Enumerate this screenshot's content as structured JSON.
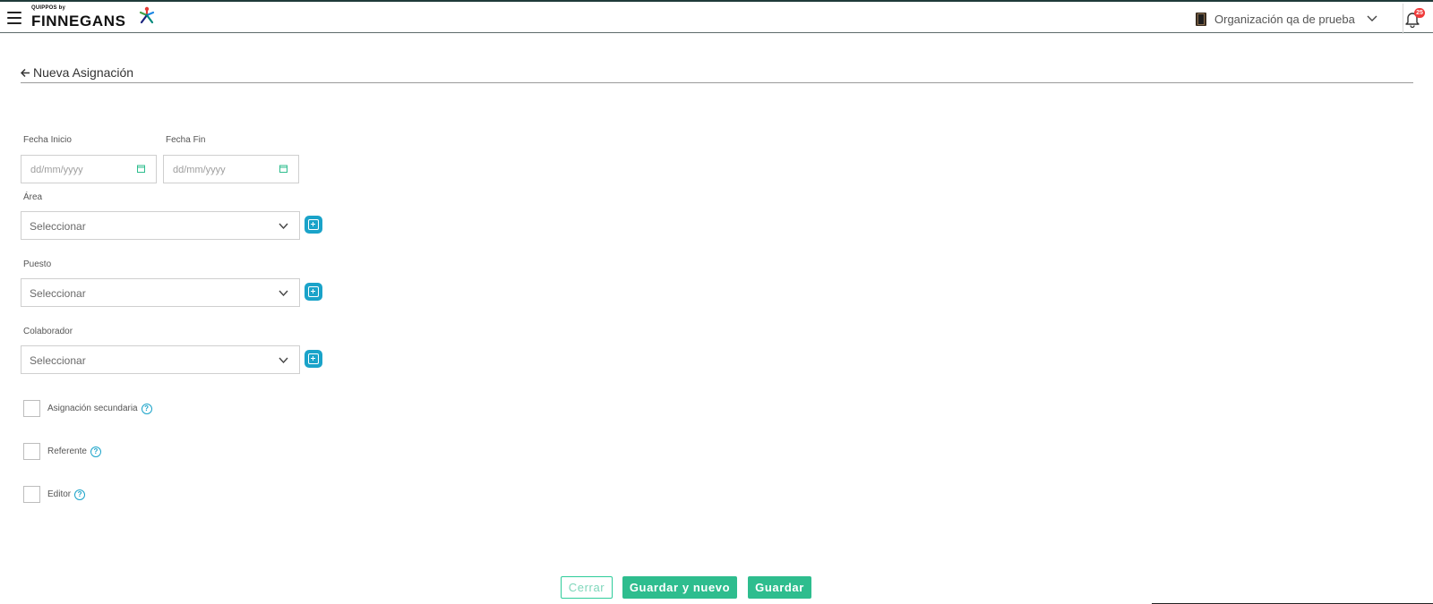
{
  "app": {
    "logo_small": "QUIPPOS by",
    "logo_main": "FINNEGANS",
    "logo_icon": "finnegans-star-icon"
  },
  "header": {
    "organization": "Organización qa de prueba",
    "org_icon": "building-icon",
    "notifications_count": "25",
    "menu_icon": "hamburger-icon",
    "bell_icon": "bell-icon"
  },
  "page": {
    "title": "Nueva Asignación",
    "back_icon": "arrow-left-icon"
  },
  "form": {
    "fecha_inicio": {
      "label": "Fecha Inicio",
      "placeholder": "dd/mm/yyyy"
    },
    "fecha_fin": {
      "label": "Fecha Fin",
      "placeholder": "dd/mm/yyyy"
    },
    "area": {
      "label": "Área",
      "value": "Seleccionar"
    },
    "puesto": {
      "label": "Puesto",
      "value": "Seleccionar"
    },
    "colaborador": {
      "label": "Colaborador",
      "value": "Seleccionar"
    },
    "checkboxes": [
      {
        "label": "Asignación secundaria",
        "checked": false
      },
      {
        "label": "Referente",
        "checked": false
      },
      {
        "label": "Editor",
        "checked": false
      }
    ],
    "help_glyph": "?"
  },
  "actions": {
    "cerrar": "Cerrar",
    "guardar_y_nuevo": "Guardar y nuevo",
    "guardar": "Guardar"
  },
  "colors": {
    "accent_green": "#2ebd8e",
    "accent_blue": "#1aa3c9",
    "badge_red": "#ef3b3b"
  }
}
